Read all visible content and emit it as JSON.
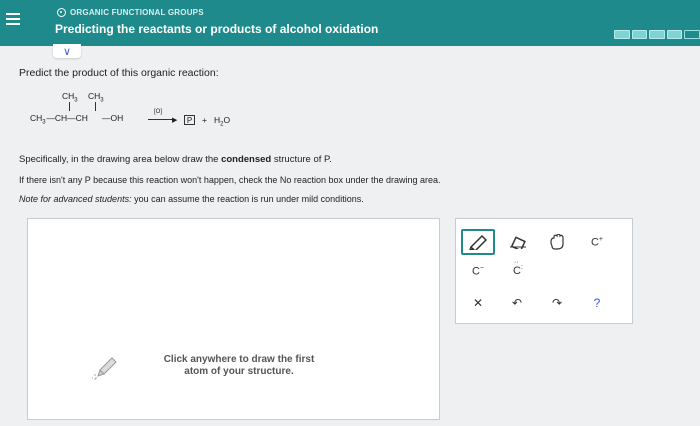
{
  "header": {
    "topic": "ORGANIC FUNCTIONAL GROUPS",
    "title": "Predicting the reactants or products of alcohol oxidation",
    "progress_segments": 5,
    "progress_filled": 4
  },
  "question": {
    "prompt": "Predict the product of this organic reaction:",
    "reaction": {
      "top_left": "CH",
      "top_left_sub": "3",
      "top_right": "CH",
      "top_right_sub": "3",
      "chain_a": "CH",
      "chain_a_sub": "3",
      "chain_b": "—CH—CH",
      "chain_c": "OH",
      "reagent": "[O]",
      "product_box": "P",
      "plus": "+",
      "water": "H",
      "water_sub": "2",
      "water_o": "O"
    },
    "specifically_pre": "Specifically, in the drawing area below draw the ",
    "specifically_bold": "condensed",
    "specifically_post": " structure of P.",
    "no_reaction": "If there isn't any P because this reaction won't happen, check the No reaction box under the drawing area.",
    "note_lead": "Note for advanced students:",
    "note_text": " you can assume the reaction is run under mild conditions."
  },
  "drawing": {
    "hint_line1": "Click anywhere to draw the first",
    "hint_line2": "atom of your structure."
  },
  "toolbar": {
    "carbanion": "C",
    "carbanion_sup": "−",
    "lone_pair": "C",
    "cation": "C",
    "cation_sup": "+",
    "help": "?"
  },
  "colors": {
    "header": "#1f8a8c",
    "accent": "#3b5bd9",
    "selected_tool_border": "#1f8a8c"
  }
}
